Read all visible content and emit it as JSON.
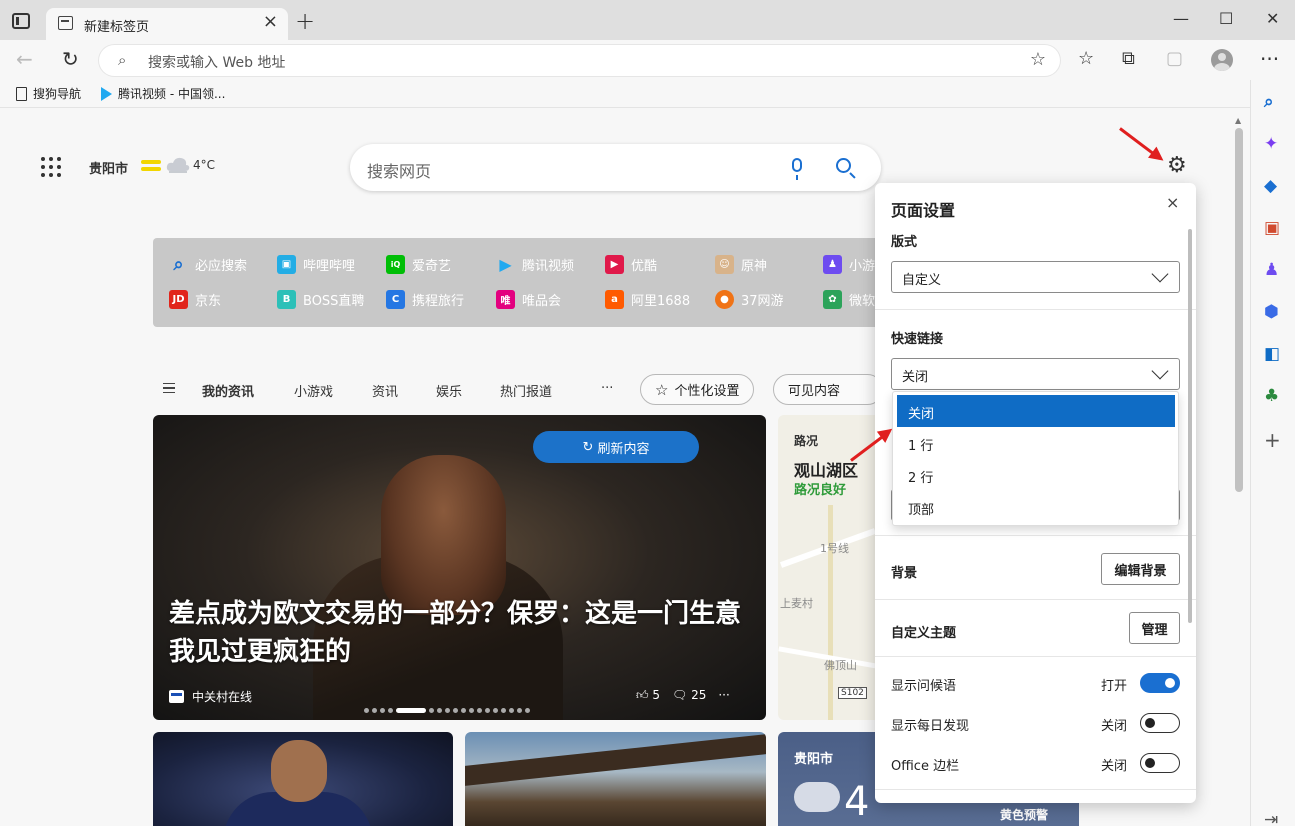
{
  "browser": {
    "tab_title": "新建标签页",
    "new_tab_symbol": "+",
    "tab_close_symbol": "×",
    "window_controls": [
      "—",
      "☐",
      "✕"
    ],
    "address_placeholder": "搜索或输入 Web 地址"
  },
  "bookmarks": [
    {
      "label": "搜狗导航",
      "icon": "document-icon"
    },
    {
      "label": "腾讯视频 - 中国领...",
      "icon": "tencent-video-icon"
    }
  ],
  "weather": {
    "city": "贵阳市",
    "temp": "4°C"
  },
  "search": {
    "placeholder": "搜索网页"
  },
  "quick_links": [
    {
      "label": "必应搜索",
      "color": "#1a6fd1",
      "glyph": "🔍"
    },
    {
      "label": "哔哩哔哩",
      "color": "#23ade5",
      "glyph": "▣"
    },
    {
      "label": "爱奇艺",
      "color": "#00be06",
      "glyph": "iQ"
    },
    {
      "label": "腾讯视频",
      "color": "#21a9f0",
      "glyph": "▶"
    },
    {
      "label": "优酷",
      "color": "#e0194a",
      "glyph": "▶"
    },
    {
      "label": "原神",
      "color": "#d8b38a",
      "glyph": "☺"
    },
    {
      "label": "小游",
      "color": "#6e4cf0",
      "glyph": "♟"
    },
    {
      "label": "京东",
      "color": "#e1251b",
      "glyph": "JD"
    },
    {
      "label": "BOSS直聘",
      "color": "#2dc0b8",
      "glyph": "B"
    },
    {
      "label": "携程旅行",
      "color": "#2577e3",
      "glyph": "C"
    },
    {
      "label": "唯品会",
      "color": "#e3007f",
      "glyph": "唯"
    },
    {
      "label": "阿里1688",
      "color": "#ff5a00",
      "glyph": "a"
    },
    {
      "label": "37网游",
      "color": "#f07316",
      "glyph": "●"
    },
    {
      "label": "微软",
      "color": "#2ca35a",
      "glyph": "✿"
    }
  ],
  "feed_nav": {
    "items": [
      "我的资讯",
      "小游戏",
      "资讯",
      "娱乐",
      "热门报道",
      "···"
    ],
    "personalize": "个性化设置",
    "visible_content": "可见内容"
  },
  "hero": {
    "refresh_label": "刷新内容",
    "title": "差点成为欧文交易的一部分？保罗：这是一门生意 我见过更疯狂的",
    "source": "中关村在线",
    "likes": "5",
    "comments": "25",
    "more": "···"
  },
  "map_card": {
    "label": "路况",
    "place": "观山湖区",
    "status": "路况良好",
    "map_texts": [
      "1号线",
      "上麦村",
      "佛顶山",
      "S102"
    ]
  },
  "weather_card": {
    "city": "贵阳市",
    "temp_digit": "4",
    "warning": "黄色预警"
  },
  "settings_panel": {
    "title": "页面设置",
    "close_symbol": "×",
    "layout_label": "版式",
    "layout_value": "自定义",
    "quicklinks_label": "快速链接",
    "quicklinks_value": "关闭",
    "background_label": "背景",
    "edit_background": "编辑背景",
    "custom_theme_label": "自定义主题",
    "manage": "管理",
    "toggles": [
      {
        "label": "显示问候语",
        "state_text": "打开",
        "on": true
      },
      {
        "label": "显示每日发现",
        "state_text": "关闭",
        "on": false
      },
      {
        "label": "Office 边栏",
        "state_text": "关闭",
        "on": false
      }
    ]
  },
  "dropdown": {
    "options": [
      "关闭",
      "1 行",
      "2 行",
      "顶部"
    ],
    "selected_index": 0
  },
  "colors": {
    "accent": "#1a6fd1",
    "selected_option": "#0f6cc5",
    "annotation_arrow": "#e01f1f",
    "traffic_good": "#2f9b3a"
  }
}
